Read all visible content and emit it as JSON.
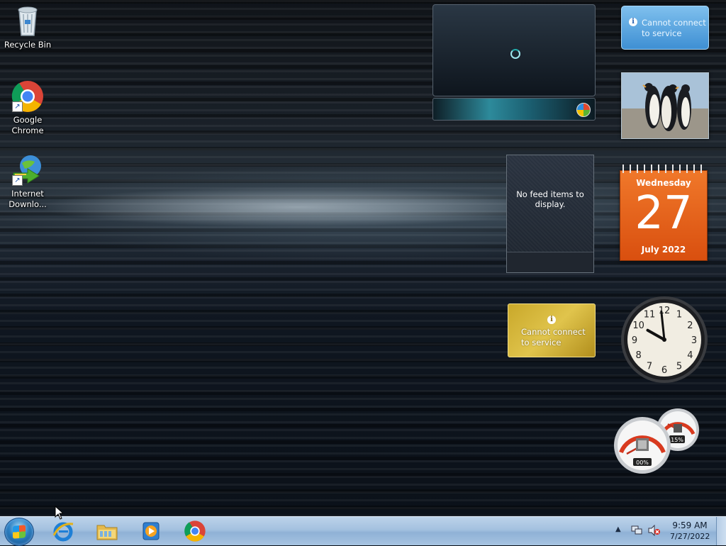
{
  "desktop_icons": [
    {
      "label": "Recycle Bin",
      "icon": "recycle-bin-icon"
    },
    {
      "label": "Google Chrome",
      "icon": "chrome-icon"
    },
    {
      "label": "Internet Downlo...",
      "icon": "internet-download-manager-icon"
    }
  ],
  "gadgets": {
    "weather": {
      "message": "Cannot connect to service"
    },
    "feed": {
      "message": "No feed items to display."
    },
    "calendar": {
      "day": "Wednesday",
      "date": "27",
      "month": "July 2022"
    },
    "currency": {
      "message": "Cannot connect to service"
    },
    "clock": {
      "hour": 9,
      "minute": 59,
      "numbers": [
        "12",
        "1",
        "2",
        "3",
        "4",
        "5",
        "6",
        "7",
        "8",
        "9",
        "10",
        "11"
      ]
    },
    "cpu_meter": {
      "cpu_label": "00%",
      "memory_label": "15%"
    }
  },
  "taskbar": {
    "pinned": [
      {
        "name": "Internet Explorer",
        "icon": "internet-explorer-icon"
      },
      {
        "name": "Windows Explorer",
        "icon": "folder-icon"
      },
      {
        "name": "Windows Media Player",
        "icon": "media-player-icon"
      },
      {
        "name": "Google Chrome",
        "icon": "chrome-icon"
      }
    ],
    "tray": {
      "time": "9:59 AM",
      "date": "7/27/2022",
      "arrow": "▲"
    }
  },
  "colors": {
    "taskbar": "#a4c1df",
    "calendar": "#e6621b",
    "weather": "#5aa5e0",
    "currency": "#d4b63a"
  }
}
